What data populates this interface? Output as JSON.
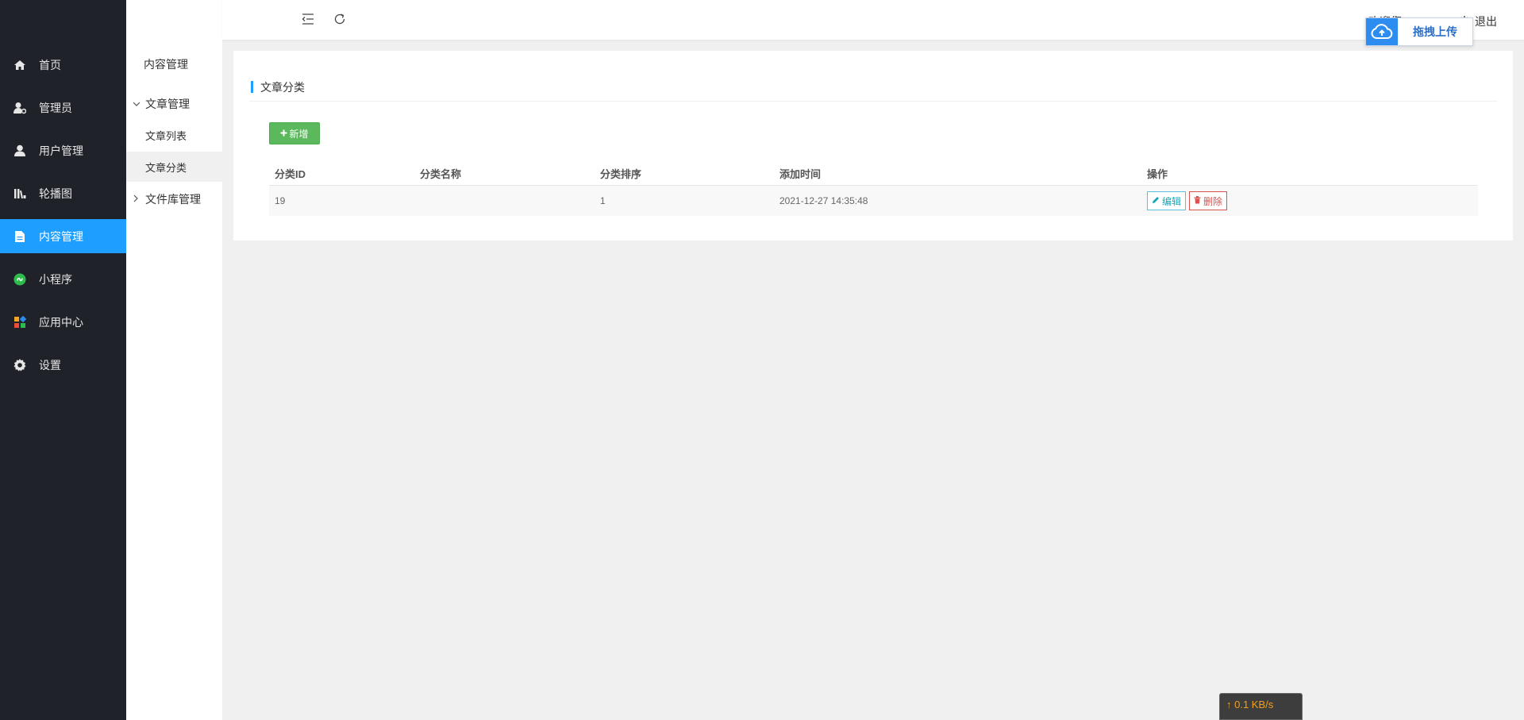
{
  "sidebar": {
    "items": [
      {
        "label": "首页",
        "icon": "home-icon"
      },
      {
        "label": "管理员",
        "icon": "admin-icon"
      },
      {
        "label": "用户管理",
        "icon": "user-icon"
      },
      {
        "label": "轮播图",
        "icon": "carousel-icon"
      },
      {
        "label": "内容管理",
        "icon": "document-icon",
        "active": true
      },
      {
        "label": "小程序",
        "icon": "miniprogram-icon"
      },
      {
        "label": "应用中心",
        "icon": "apps-icon"
      },
      {
        "label": "设置",
        "icon": "gear-icon"
      }
    ],
    "active_color": "#1e9fff",
    "bg_color": "#20222a"
  },
  "submenu": {
    "title": "内容管理",
    "groups": [
      {
        "label": "文章管理",
        "expanded": true,
        "items": [
          {
            "label": "文章列表"
          },
          {
            "label": "文章分类",
            "active": true
          }
        ]
      },
      {
        "label": "文件库管理",
        "expanded": false
      }
    ]
  },
  "header": {
    "welcome": "欢迎您",
    "logout": "退出"
  },
  "upload_widget": {
    "label": "拖拽上传"
  },
  "card": {
    "title": "文章分类",
    "add_button": "新增",
    "table": {
      "columns": [
        "分类ID",
        "分类名称",
        "分类排序",
        "添加时间",
        "操作"
      ],
      "rows": [
        {
          "id": "19",
          "name": "",
          "sort": "1",
          "time": "2021-12-27 14:35:48",
          "edit": "编辑",
          "delete": "删除"
        }
      ]
    }
  },
  "netspeed": {
    "up": "↑ 0.1 KB/s"
  }
}
